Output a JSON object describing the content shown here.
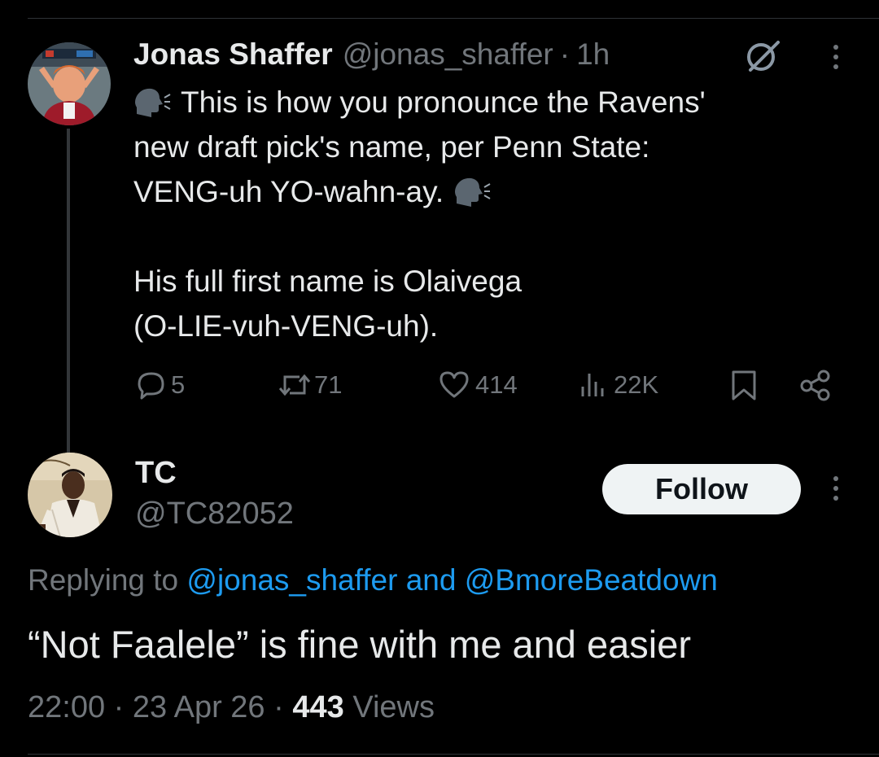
{
  "parent_tweet": {
    "author_name": "Jonas Shaffer",
    "handle": "@jonas_shaffer",
    "separator": "·",
    "time": "1h",
    "lines": [
      "This is how you pronounce the Ravens'",
      "new draft pick's name, per Penn State:",
      "VENG-uh YO-wahn-ay.",
      "",
      "His full first name is Olaivega",
      "(O-LIE-vuh-VENG-uh)."
    ],
    "icons": {
      "speaking": "speaking-head-icon",
      "grok": "grok-icon",
      "more": "more-icon"
    },
    "actions": {
      "replies": "5",
      "reposts": "71",
      "likes": "414",
      "views": "22K"
    }
  },
  "reply_tweet": {
    "author_name": "TC",
    "handle": "@TC82052",
    "follow_label": "Follow",
    "replying_prefix": "Replying to",
    "mention_1": "@jonas_shaffer",
    "connector": "and",
    "mention_2": "@BmoreBeatdown",
    "text": "“Not Faalele” is fine with me and easier",
    "time": "22:00",
    "date": "23 Apr 26",
    "separator": "·",
    "views_count": "443",
    "views_label": "Views"
  },
  "colors": {
    "background": "#000000",
    "text_primary": "#e7e9ea",
    "text_secondary": "#71767b",
    "link": "#1d9bf0",
    "follow_button_bg": "#eff3f4"
  }
}
